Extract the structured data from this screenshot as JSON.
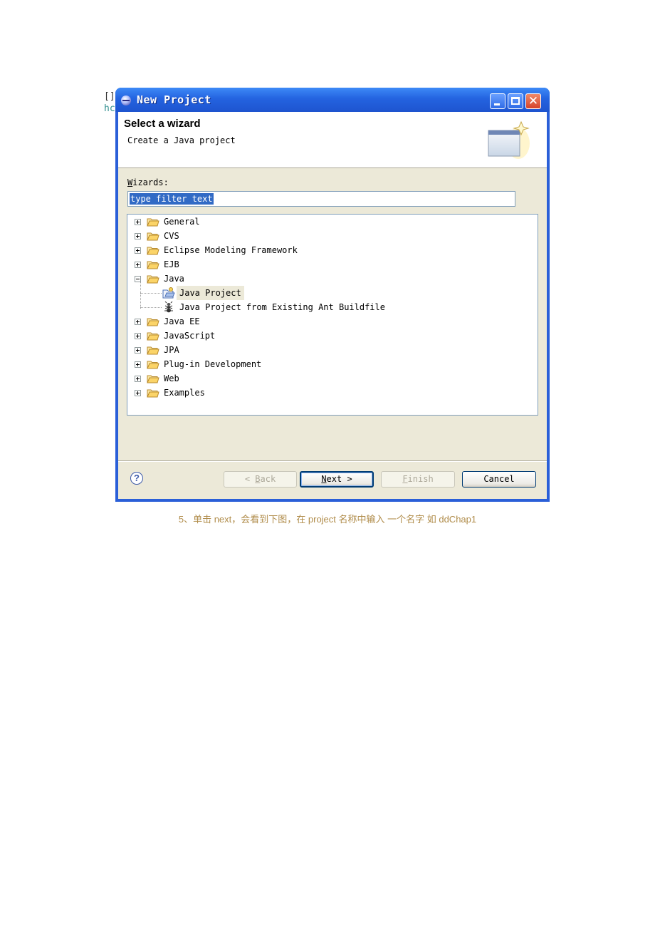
{
  "background_code": {
    "line1": "[]",
    "line2": "hc"
  },
  "window": {
    "title": "New Project",
    "controls": {
      "close_glyph": "✕"
    }
  },
  "banner": {
    "title": "Select a wizard",
    "description": "Create a Java project",
    "icon": "wizard-banner-icon"
  },
  "wizards": {
    "label_mnemonic": "W",
    "label_rest": "izards:",
    "filter_value": "type filter text"
  },
  "tree": {
    "items": [
      {
        "label": "General",
        "expanded": false
      },
      {
        "label": "CVS",
        "expanded": false
      },
      {
        "label": "Eclipse Modeling Framework",
        "expanded": false
      },
      {
        "label": "EJB",
        "expanded": false
      },
      {
        "label": "Java",
        "expanded": true
      },
      {
        "label": "Java Project",
        "child": true,
        "selected": true,
        "icon": "java-project-icon"
      },
      {
        "label": "Java Project from Existing Ant Buildfile",
        "child": true,
        "icon": "ant-icon"
      },
      {
        "label": "Java EE",
        "expanded": false
      },
      {
        "label": "JavaScript",
        "expanded": false
      },
      {
        "label": "JPA",
        "expanded": false
      },
      {
        "label": "Plug-in Development",
        "expanded": false
      },
      {
        "label": "Web",
        "expanded": false
      },
      {
        "label": "Examples",
        "expanded": false
      }
    ]
  },
  "buttons": {
    "help": "?",
    "back_prefix": "< ",
    "back_mnemonic": "B",
    "back_rest": "ack",
    "next_mnemonic": "N",
    "next_rest": "ext >",
    "finish_mnemonic": "F",
    "finish_rest": "inish",
    "cancel": "Cancel"
  },
  "caption": "5、单击 next，会看到下图，在 project 名称中输入 一个名字 如 ddChap1"
}
